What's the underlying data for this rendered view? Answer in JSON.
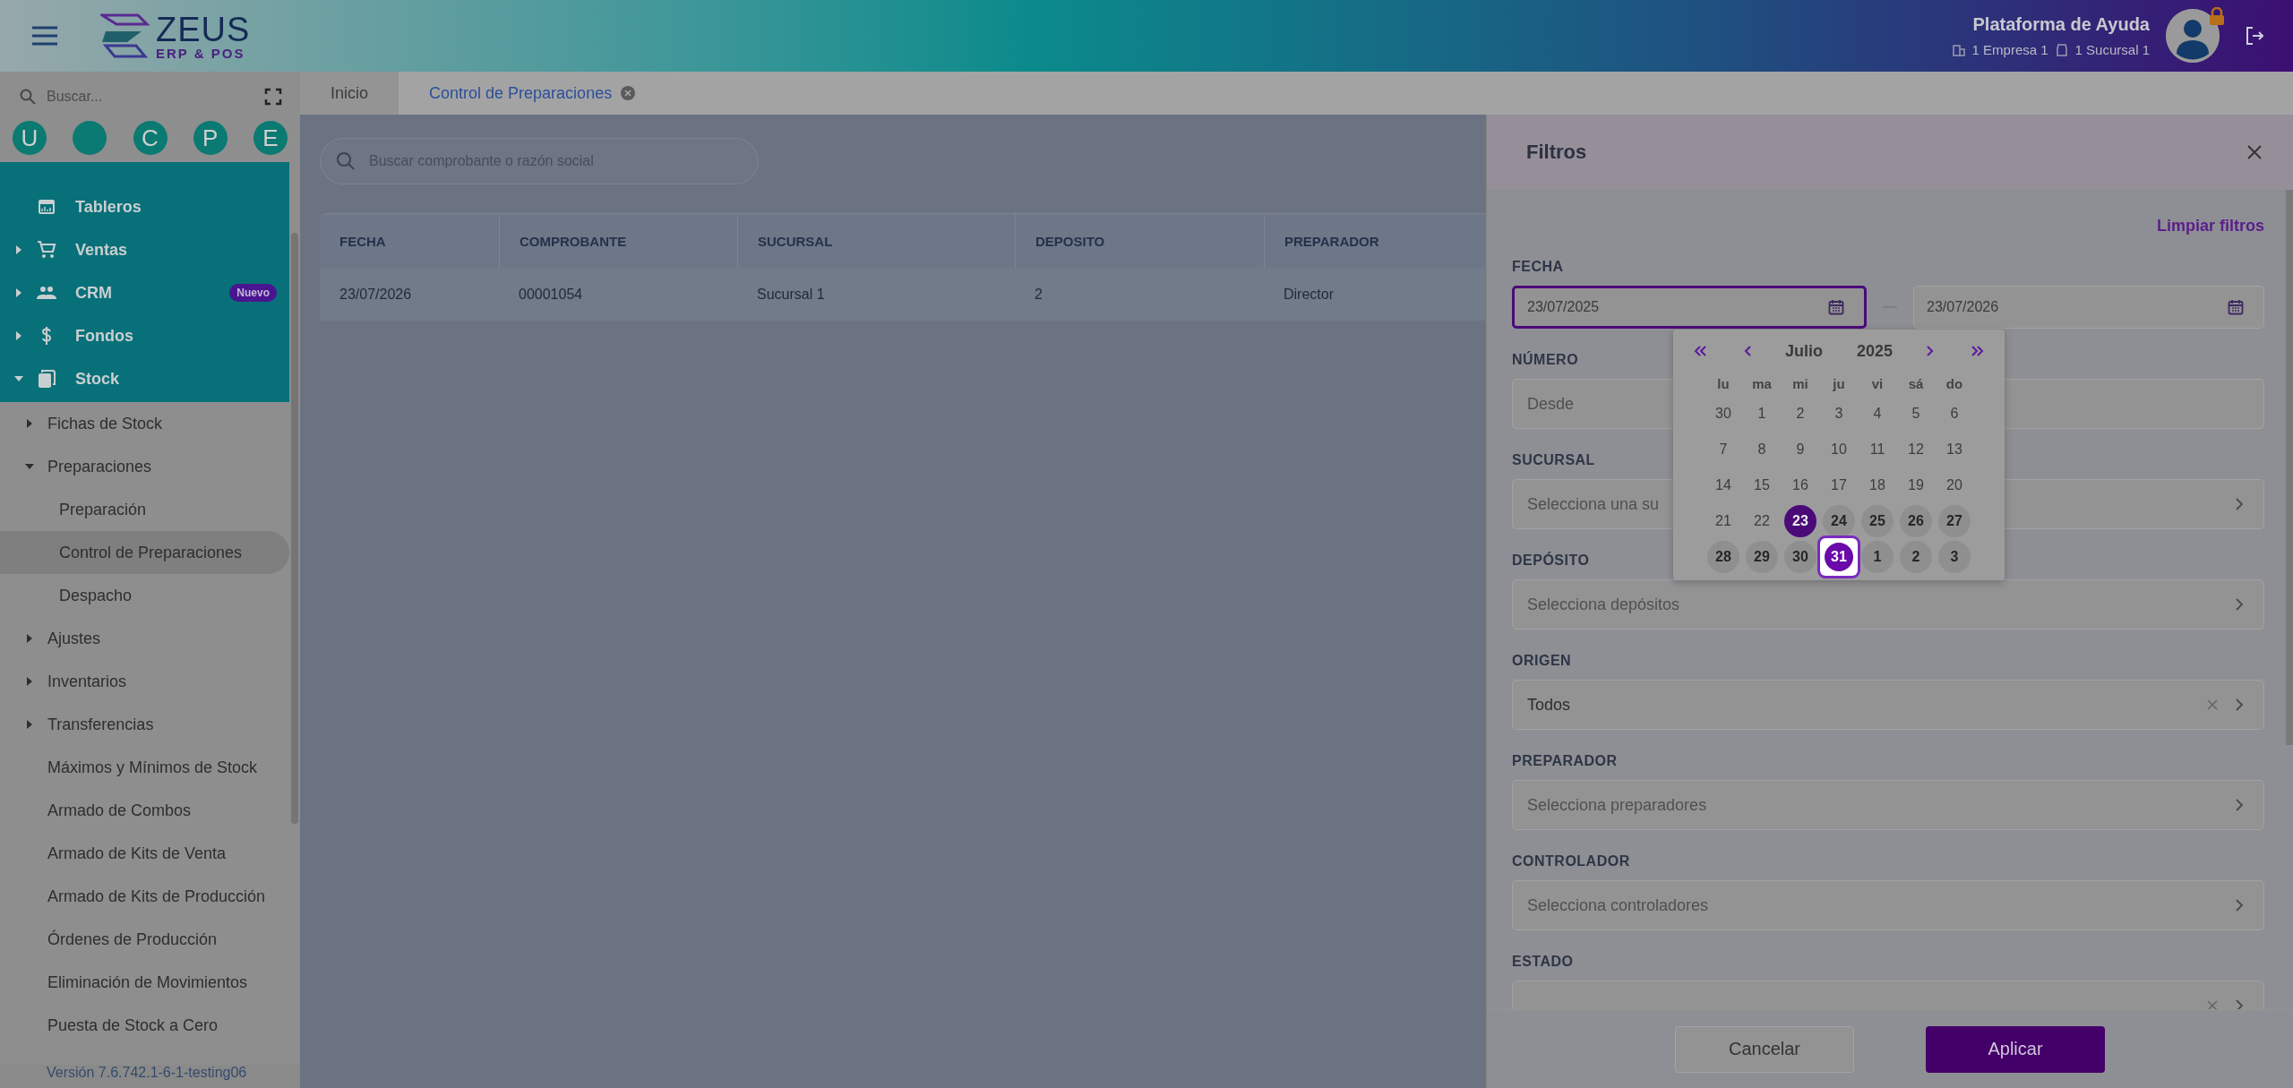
{
  "header": {
    "brand": "ZEUS",
    "brand_sub": "ERP & POS",
    "user_name": "Plataforma de Ayuda",
    "company": "1 Empresa 1",
    "branch": "1 Sucursal 1"
  },
  "sidebar": {
    "search_placeholder": "Buscar...",
    "quick_access": [
      {
        "kind": "letter",
        "letter": "U"
      },
      {
        "kind": "blank"
      },
      {
        "kind": "letter",
        "letter": "C"
      },
      {
        "kind": "letter",
        "letter": "P"
      },
      {
        "kind": "letter",
        "letter": "E"
      }
    ],
    "modules": [
      {
        "label": "Tableros",
        "kind": "leaf"
      },
      {
        "label": "Ventas",
        "kind": "group",
        "expanded": false
      },
      {
        "label": "CRM",
        "kind": "group",
        "expanded": false,
        "badge": "Nuevo"
      },
      {
        "label": "Fondos",
        "kind": "group",
        "expanded": false
      },
      {
        "label": "Stock",
        "kind": "group",
        "expanded": true,
        "children": [
          {
            "label": "Fichas de Stock",
            "kind": "group",
            "expanded": false
          },
          {
            "label": "Preparaciones",
            "kind": "group",
            "expanded": true,
            "children": [
              {
                "label": "Preparación",
                "selected": false
              },
              {
                "label": "Control de Preparaciones",
                "selected": true
              },
              {
                "label": "Despacho",
                "selected": false
              }
            ]
          },
          {
            "label": "Ajustes",
            "kind": "group",
            "expanded": false
          },
          {
            "label": "Inventarios",
            "kind": "group",
            "expanded": false
          },
          {
            "label": "Transferencias",
            "kind": "group",
            "expanded": false
          },
          {
            "label": "Máximos y Mínimos de Stock",
            "kind": "leaf"
          },
          {
            "label": "Armado de Combos",
            "kind": "leaf"
          },
          {
            "label": "Armado de Kits de Venta",
            "kind": "leaf"
          },
          {
            "label": "Armado de Kits de Producción",
            "kind": "leaf"
          },
          {
            "label": "Órdenes de Producción",
            "kind": "leaf"
          },
          {
            "label": "Eliminación de Movimientos",
            "kind": "leaf"
          },
          {
            "label": "Puesta de Stock a Cero",
            "kind": "leaf"
          }
        ]
      }
    ],
    "version": "Versión 7.6.742.1-6-1-testing06"
  },
  "tabs": [
    {
      "label": "Inicio",
      "selected": false,
      "closable": false
    },
    {
      "label": "Control de Preparaciones",
      "selected": true,
      "closable": true
    }
  ],
  "search": {
    "placeholder": "Buscar comprobante o razón social"
  },
  "table": {
    "columns": [
      "FECHA",
      "COMPROBANTE",
      "SUCURSAL",
      "DEPOSITO",
      "PREPARADOR"
    ],
    "rows": [
      [
        "23/07/2026",
        "00001054",
        "Sucursal 1",
        "2",
        "Director"
      ]
    ]
  },
  "filters": {
    "title": "Filtros",
    "clear": "Limpiar filtros",
    "date": {
      "label": "FECHA",
      "from": "23/07/2025",
      "to": "23/07/2026",
      "from_focused": true
    },
    "calendar": {
      "month": "Julio",
      "year": "2025",
      "weekdays": [
        "lu",
        "ma",
        "mi",
        "ju",
        "vi",
        "sá",
        "do"
      ],
      "weeks": [
        [
          {
            "d": "30",
            "kind": "day"
          },
          {
            "d": "1",
            "kind": "day"
          },
          {
            "d": "2",
            "kind": "day"
          },
          {
            "d": "3",
            "kind": "day"
          },
          {
            "d": "4",
            "kind": "day"
          },
          {
            "d": "5",
            "kind": "day"
          },
          {
            "d": "6",
            "kind": "day"
          }
        ],
        [
          {
            "d": "7",
            "kind": "day"
          },
          {
            "d": "8",
            "kind": "day"
          },
          {
            "d": "9",
            "kind": "day"
          },
          {
            "d": "10",
            "kind": "day"
          },
          {
            "d": "11",
            "kind": "day"
          },
          {
            "d": "12",
            "kind": "day"
          },
          {
            "d": "13",
            "kind": "day"
          }
        ],
        [
          {
            "d": "14",
            "kind": "day"
          },
          {
            "d": "15",
            "kind": "day"
          },
          {
            "d": "16",
            "kind": "day"
          },
          {
            "d": "17",
            "kind": "day"
          },
          {
            "d": "18",
            "kind": "day"
          },
          {
            "d": "19",
            "kind": "day"
          },
          {
            "d": "20",
            "kind": "day"
          }
        ],
        [
          {
            "d": "21",
            "kind": "day"
          },
          {
            "d": "22",
            "kind": "day"
          },
          {
            "d": "23",
            "kind": "start"
          },
          {
            "d": "24",
            "kind": "range"
          },
          {
            "d": "25",
            "kind": "range"
          },
          {
            "d": "26",
            "kind": "range"
          },
          {
            "d": "27",
            "kind": "range"
          }
        ],
        [
          {
            "d": "28",
            "kind": "range"
          },
          {
            "d": "29",
            "kind": "range"
          },
          {
            "d": "30",
            "kind": "range"
          },
          {
            "d": "31",
            "kind": "end"
          },
          {
            "d": "1",
            "kind": "range"
          },
          {
            "d": "2",
            "kind": "range"
          },
          {
            "d": "3",
            "kind": "range"
          }
        ]
      ]
    },
    "fields": [
      {
        "label": "NÚMERO",
        "kind": "text",
        "placeholder": "Desde"
      },
      {
        "label": "SUCURSAL",
        "kind": "select",
        "placeholder": "Selecciona una su",
        "clearable": false
      },
      {
        "label": "DEPÓSITO",
        "kind": "select",
        "placeholder": "Selecciona depósitos",
        "clearable": false
      },
      {
        "label": "ORIGEN",
        "kind": "select",
        "value": "Todos",
        "clearable": true
      },
      {
        "label": "PREPARADOR",
        "kind": "select",
        "placeholder": "Selecciona preparadores",
        "clearable": false
      },
      {
        "label": "CONTROLADOR",
        "kind": "select",
        "placeholder": "Selecciona controladores",
        "clearable": false
      },
      {
        "label": "ESTADO",
        "kind": "select",
        "clearable": true
      }
    ],
    "buttons": [
      {
        "label": "Cancelar",
        "kind": "secondary"
      },
      {
        "label": "Aplicar",
        "kind": "primary"
      }
    ]
  }
}
